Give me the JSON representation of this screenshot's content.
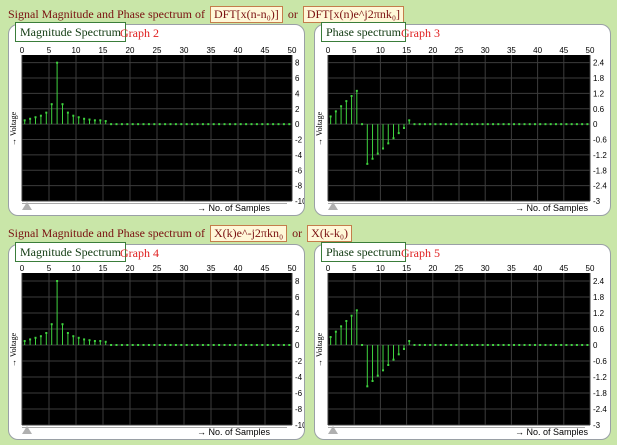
{
  "sections": [
    {
      "prefix": "Signal Magnitude and Phase spectrum of",
      "box1": "DFT[x(n-n₀)]",
      "mid": "or",
      "box2": "DFT[x(n)e^j2πnk₀]"
    },
    {
      "prefix": "Signal Magnitude and Phase spectrum of",
      "box1": "X(k)e^-j2πkn₀",
      "mid": "or",
      "box2": "X(k-k₀)"
    }
  ],
  "panels": [
    {
      "title": "Magnitude Spectrum",
      "graph": "Graph 2",
      "y_axis_label": "Voltage",
      "x_axis_label": "No. of Samples",
      "y_ticks": [
        "8",
        "6",
        "4",
        "2",
        "0",
        "-2",
        "-4",
        "-6",
        "-8",
        "-10"
      ],
      "x_ticks": [
        "0",
        "5",
        "10",
        "15",
        "20",
        "25",
        "30",
        "35",
        "40",
        "45",
        "50"
      ]
    },
    {
      "title": "Phase spectrum",
      "graph": "Graph 3",
      "y_axis_label": "Voltage",
      "x_axis_label": "No. of Samples",
      "y_ticks": [
        "2.4",
        "1.8",
        "1.2",
        "0.6",
        "0",
        "-0.6",
        "-1.2",
        "-1.8",
        "-2.4",
        "-3"
      ],
      "x_ticks": [
        "0",
        "5",
        "10",
        "15",
        "20",
        "25",
        "30",
        "35",
        "40",
        "45",
        "50"
      ]
    },
    {
      "title": "Magnitude Spectrum",
      "graph": "Graph 4",
      "y_axis_label": "Voltage",
      "x_axis_label": "No. of Samples",
      "y_ticks": [
        "8",
        "6",
        "4",
        "2",
        "0",
        "-2",
        "-4",
        "-6",
        "-8",
        "-10"
      ],
      "x_ticks": [
        "0",
        "5",
        "10",
        "15",
        "20",
        "25",
        "30",
        "35",
        "40",
        "45",
        "50"
      ]
    },
    {
      "title": "Phase spectrum",
      "graph": "Graph 5",
      "y_axis_label": "Voltage",
      "x_axis_label": "No. of Samples",
      "y_ticks": [
        "2.4",
        "1.8",
        "1.2",
        "0.6",
        "0",
        "-0.6",
        "-1.2",
        "-1.8",
        "-2.4",
        "-3"
      ],
      "x_ticks": [
        "0",
        "5",
        "10",
        "15",
        "20",
        "25",
        "30",
        "35",
        "40",
        "45",
        "50"
      ]
    }
  ],
  "colors": {
    "background": "#c9e6a8",
    "plot_bg": "#000000",
    "stem": "#3fd43f",
    "grid": "#3c3c3c",
    "title_red": "#e02020"
  },
  "chart_data": [
    {
      "type": "scatter",
      "title": "Graph 2",
      "xlabel": "No. of Samples",
      "ylabel": "Voltage",
      "xlim": [
        0,
        50
      ],
      "ylim": [
        -10,
        9
      ],
      "x": [
        0,
        1,
        2,
        3,
        4,
        5,
        6,
        7,
        8,
        9,
        10,
        11,
        12,
        13,
        14,
        15,
        16,
        17,
        18,
        19,
        20,
        21,
        22,
        23,
        24,
        25,
        26,
        27,
        28,
        29,
        30,
        31,
        32,
        33,
        34,
        35,
        36,
        37,
        38,
        39,
        40,
        41,
        42,
        43,
        44,
        45,
        46,
        47,
        48,
        49
      ],
      "values": [
        0.5,
        0.7,
        0.9,
        1.1,
        1.5,
        2.6,
        8,
        2.6,
        1.5,
        1.1,
        0.9,
        0.7,
        0.6,
        0.5,
        0.5,
        0.4,
        0,
        0,
        0,
        0,
        0,
        0,
        0,
        0,
        0,
        0,
        0,
        0,
        0,
        0,
        0,
        0,
        0,
        0,
        0,
        0,
        0,
        0,
        0,
        0,
        0,
        0,
        0,
        0,
        0,
        0,
        0,
        0,
        0,
        0
      ]
    },
    {
      "type": "scatter",
      "title": "Graph 3",
      "xlabel": "No. of Samples",
      "ylabel": "Voltage",
      "xlim": [
        0,
        50
      ],
      "ylim": [
        -3,
        2.7
      ],
      "x": [
        0,
        1,
        2,
        3,
        4,
        5,
        6,
        7,
        8,
        9,
        10,
        11,
        12,
        13,
        14,
        15,
        16,
        17,
        18,
        19,
        20,
        21,
        22,
        23,
        24,
        25,
        26,
        27,
        28,
        29,
        30,
        31,
        32,
        33,
        34,
        35,
        36,
        37,
        38,
        39,
        40,
        41,
        42,
        43,
        44,
        45,
        46,
        47,
        48,
        49
      ],
      "values": [
        0.3,
        0.5,
        0.7,
        0.9,
        1.1,
        1.3,
        0,
        -1.55,
        -1.35,
        -1.15,
        -0.95,
        -0.75,
        -0.55,
        -0.35,
        -0.15,
        0.15,
        0,
        0,
        0,
        0,
        0,
        0,
        0,
        0,
        0,
        0,
        0,
        0,
        0,
        0,
        0,
        0,
        0,
        0,
        0,
        0,
        0,
        0,
        0,
        0,
        0,
        0,
        0,
        0,
        0,
        0,
        0,
        0,
        0,
        0
      ]
    },
    {
      "type": "scatter",
      "title": "Graph 4",
      "xlabel": "No. of Samples",
      "ylabel": "Voltage",
      "xlim": [
        0,
        50
      ],
      "ylim": [
        -10,
        9
      ],
      "x": [
        0,
        1,
        2,
        3,
        4,
        5,
        6,
        7,
        8,
        9,
        10,
        11,
        12,
        13,
        14,
        15,
        16,
        17,
        18,
        19,
        20,
        21,
        22,
        23,
        24,
        25,
        26,
        27,
        28,
        29,
        30,
        31,
        32,
        33,
        34,
        35,
        36,
        37,
        38,
        39,
        40,
        41,
        42,
        43,
        44,
        45,
        46,
        47,
        48,
        49
      ],
      "values": [
        0.5,
        0.7,
        0.9,
        1.1,
        1.5,
        2.6,
        8,
        2.6,
        1.5,
        1.1,
        0.9,
        0.7,
        0.6,
        0.5,
        0.5,
        0.4,
        0,
        0,
        0,
        0,
        0,
        0,
        0,
        0,
        0,
        0,
        0,
        0,
        0,
        0,
        0,
        0,
        0,
        0,
        0,
        0,
        0,
        0,
        0,
        0,
        0,
        0,
        0,
        0,
        0,
        0,
        0,
        0,
        0,
        0
      ]
    },
    {
      "type": "scatter",
      "title": "Graph 5",
      "xlabel": "No. of Samples",
      "ylabel": "Voltage",
      "xlim": [
        0,
        50
      ],
      "ylim": [
        -3,
        2.7
      ],
      "x": [
        0,
        1,
        2,
        3,
        4,
        5,
        6,
        7,
        8,
        9,
        10,
        11,
        12,
        13,
        14,
        15,
        16,
        17,
        18,
        19,
        20,
        21,
        22,
        23,
        24,
        25,
        26,
        27,
        28,
        29,
        30,
        31,
        32,
        33,
        34,
        35,
        36,
        37,
        38,
        39,
        40,
        41,
        42,
        43,
        44,
        45,
        46,
        47,
        48,
        49
      ],
      "values": [
        0.3,
        0.5,
        0.7,
        0.9,
        1.1,
        1.3,
        0,
        -1.55,
        -1.35,
        -1.15,
        -0.95,
        -0.75,
        -0.55,
        -0.35,
        -0.15,
        0.15,
        0,
        0,
        0,
        0,
        0,
        0,
        0,
        0,
        0,
        0,
        0,
        0,
        0,
        0,
        0,
        0,
        0,
        0,
        0,
        0,
        0,
        0,
        0,
        0,
        0,
        0,
        0,
        0,
        0,
        0,
        0,
        0,
        0,
        0
      ]
    }
  ]
}
